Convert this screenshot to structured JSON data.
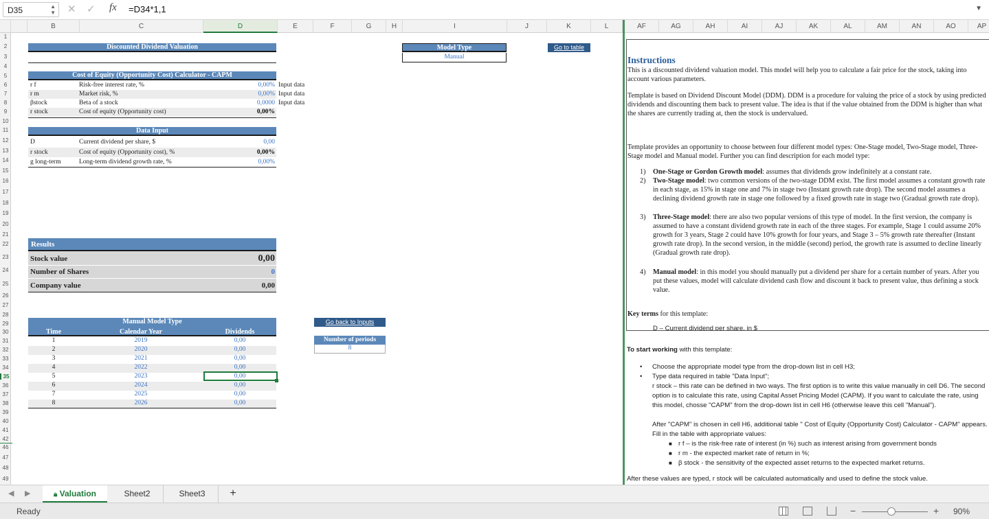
{
  "formula_bar": {
    "cell_ref": "D35",
    "cancel_icon": "✕",
    "confirm_icon": "✓",
    "fx_label": "fx",
    "formula": "=D34*1,1"
  },
  "columns": [
    "B",
    "C",
    "D",
    "E",
    "F",
    "G",
    "H",
    "I",
    "J",
    "K",
    "L",
    "AF",
    "AG",
    "AH",
    "AI",
    "AJ",
    "AK",
    "AL",
    "AM",
    "AN",
    "AO",
    "AP"
  ],
  "active_column": "D",
  "rows": [
    "1",
    "2",
    "3",
    "4",
    "5",
    "6",
    "7",
    "8",
    "9",
    "10",
    "11",
    "12",
    "13",
    "14",
    "15",
    "16",
    "17",
    "18",
    "19",
    "20",
    "21",
    "22",
    "23",
    "24",
    "25",
    "26",
    "27",
    "28",
    "29",
    "30",
    "31",
    "32",
    "33",
    "34",
    "35",
    "36",
    "37",
    "38",
    "39",
    "40",
    "41",
    "42",
    "46",
    "47",
    "48",
    "49",
    "50"
  ],
  "active_row": "35",
  "valuation": {
    "main_title": "Discounted Dividend Valuation",
    "model_type_label": "Model Type",
    "model_type_value": "Manual",
    "go_to_table": "Go to table",
    "capm": {
      "title": "Cost of Equity (Opportunity Cost) Calculator - CAPM",
      "rows": [
        {
          "symbol": "r f",
          "label": "Risk-free interest rate, %",
          "value": "0,00%",
          "note": "Input data"
        },
        {
          "symbol": "r m",
          "label": "Market risk, %",
          "value": "0,00%",
          "note": "Input data"
        },
        {
          "symbol": "βstock",
          "label": "Beta of a stock",
          "value": "0,0000",
          "note": "Input data"
        },
        {
          "symbol": "r stock",
          "label": "Cost of equity (Opportunity cost)",
          "value": "0,00%",
          "note": ""
        }
      ]
    },
    "data_input": {
      "title": "Data Input",
      "rows": [
        {
          "symbol": "D",
          "label": "Current dividend per share, $",
          "value": "0,00"
        },
        {
          "symbol": "r stock",
          "label": "Cost of equity (Opportunity cost), %",
          "value": "0,00%"
        },
        {
          "symbol": "g long-term",
          "label": "Long-term dividend growth rate, %",
          "value": "0,00%"
        }
      ]
    },
    "results": {
      "title": "Results",
      "rows": [
        {
          "label": "Stock value",
          "value": "0,00"
        },
        {
          "label": "Number of Shares",
          "value": "0"
        },
        {
          "label": "Company value",
          "value": "0,00"
        }
      ]
    },
    "manual_model": {
      "title": "Manual Model Type",
      "headers": [
        "Time",
        "Calendar Year",
        "Dividends"
      ],
      "rows": [
        {
          "time": "1",
          "year": "2019",
          "dividend": "0,00"
        },
        {
          "time": "2",
          "year": "2020",
          "dividend": "0,00"
        },
        {
          "time": "3",
          "year": "2021",
          "dividend": "0,00"
        },
        {
          "time": "4",
          "year": "2022",
          "dividend": "0,00"
        },
        {
          "time": "5",
          "year": "2023",
          "dividend": "0,00"
        },
        {
          "time": "6",
          "year": "2024",
          "dividend": "0,00"
        },
        {
          "time": "7",
          "year": "2025",
          "dividend": "0,00"
        },
        {
          "time": "8",
          "year": "2026",
          "dividend": "0,00"
        }
      ]
    },
    "go_back": "Go back to Inputs",
    "periods_label": "Number of periods",
    "periods_value": "8"
  },
  "instructions": {
    "title": "Instructions",
    "intro": "This is a discounted dividend valuation model. This model will help you to calculate a fair price for the stock, taking into account various parameters.",
    "ddm": "Template is based on Dividend Discount Model (DDM). DDM is a procedure for valuing the price of a stock by using predicted dividends and discounting them back to present value. The idea is that if the value obtained from the DDM is higher than what the shares are currently trading at, then the stock is undervalued.",
    "choose": "Template provides an opportunity to choose between four different model types: One-Stage model, Two-Stage model, Three-Stage model and Manual model. Further you can find description for each model type:",
    "models": [
      {
        "num": "1)",
        "name": "One-Stage or Gordon Growth model",
        "text": ": assumes that dividends grow indefinitely at a constant rate."
      },
      {
        "num": "2)",
        "name": "Two-Stage model",
        "text": ": two common versions of the two-stage DDM exist. The first model assumes a constant growth rate in each stage, as 15% in stage one and 7% in stage two (Instant growth rate drop). The second model assumes a declining dividend growth rate in stage one followed by a fixed growth rate in stage two (Gradual growth rate drop)."
      },
      {
        "num": "3)",
        "name": "Three-Stage model",
        "text": ": there are also two popular versions of this type of model. In the first version, the company is assumed to have a constant dividend growth rate in each of the three stages. For example, Stage 1 could assume 20% growth for 3 years, Stage 2 could have 10% growth for four years, and Stage 3 – 5% growth rate thereafter (Instant growth rate drop). In the second version, in the middle (second) period, the growth rate is assumed to decline linearly (Gradual growth rate drop)."
      },
      {
        "num": "4)",
        "name": "Manual model",
        "text": ": in this model you should manually put a dividend per share for a certain number of years. After you put these values, model will calculate dividend cash flow and discount it back to present value, thus defining a stock value."
      }
    ],
    "key_terms_bold": "Key terms",
    "key_terms_rest": " for this template:",
    "clipped_line": "D – Current dividend per share, in $"
  },
  "start": {
    "heading_bold": "To start working",
    "heading_rest": " with this template:",
    "bullets": [
      "Choose the appropriate model type from the drop-down list in cell H3;",
      "Type data required in table \"Data Input\";"
    ],
    "rstock_text": "r stock – this rate can be defined in two ways. The first option is to write this value manually in cell D6. The second option is to calculate this rate, using Capital Asset Pricing Model (CAPM). If you want to calculate the rate, using this model, chosse \"CAPM\" from the drop-down list in cell H6 (otherwise leave this cell \"Manual\").",
    "capm_text": "After \"CAPM\" is chosen in cell H6, additional table \" Cost of Equity (Opportunity Cost) Calculator - CAPM\" appears. Fill in the table with appropriate values:",
    "sub_bullets": [
      "r f – is the risk-free rate of interest (in %) such as interest arising from government bonds",
      "r m - the expected market rate of return in %;",
      "β stock - the sensitivity of the expected asset returns to the expected market returns."
    ],
    "after": "After these values are typed, r stock will be calculated automatically and used to define the stock value."
  },
  "tabs": [
    "Valuation",
    "Sheet2",
    "Sheet3"
  ],
  "add_sheet_label": "+",
  "status": {
    "ready": "Ready",
    "zoom_minus": "−",
    "zoom_plus": "+",
    "zoom": "90%"
  }
}
